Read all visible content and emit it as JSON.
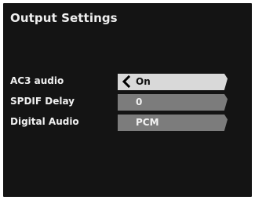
{
  "screen": {
    "title": "Output Settings"
  },
  "settings": [
    {
      "label": "AC3 audio",
      "value": "On",
      "selected": true
    },
    {
      "label": "SPDIF Delay",
      "value": "0",
      "selected": false
    },
    {
      "label": "Digital Audio",
      "value": "PCM",
      "selected": false
    }
  ],
  "icons": {
    "selection": "chevron-left-icon"
  },
  "colors": {
    "background": "#141414",
    "selected_field": "#d9d9d9",
    "field": "#7c7c7c",
    "text": "#f0f0f0",
    "selected_text": "#101010"
  }
}
